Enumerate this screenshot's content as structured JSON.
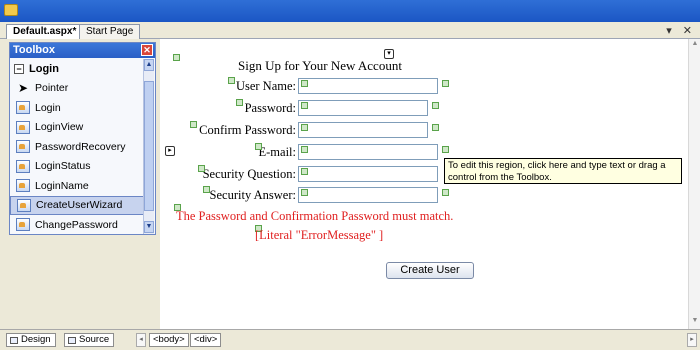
{
  "document_tabs": [
    {
      "label": "Default.aspx*",
      "active": true
    },
    {
      "label": "Start Page",
      "active": false
    }
  ],
  "tab_controls": "▾ ✕",
  "toolbox": {
    "title": "Toolbox",
    "group": {
      "expander": "−",
      "label": "Login"
    },
    "items": [
      {
        "label": "Pointer",
        "icon": "pointer-icon"
      },
      {
        "label": "Login",
        "icon": "login-icon"
      },
      {
        "label": "LoginView",
        "icon": "loginview-icon"
      },
      {
        "label": "PasswordRecovery",
        "icon": "passwordrecovery-icon"
      },
      {
        "label": "LoginStatus",
        "icon": "loginstatus-icon"
      },
      {
        "label": "LoginName",
        "icon": "loginname-icon"
      },
      {
        "label": "CreateUserWizard",
        "icon": "createuserwizard-icon",
        "selected": true
      },
      {
        "label": "ChangePassword",
        "icon": "changepassword-icon"
      }
    ]
  },
  "wizard": {
    "title": "Sign Up for Your New Account",
    "fields": [
      {
        "label": "User Name:"
      },
      {
        "label": "Password:"
      },
      {
        "label": "Confirm Password:"
      },
      {
        "label": "E-mail:"
      },
      {
        "label": "Security Question:"
      },
      {
        "label": "Security Answer:"
      }
    ],
    "compare_error": "The Password and Confirmation Password must match.",
    "literal_error": "[Literal \"ErrorMessage\" ]",
    "create_button": "Create User"
  },
  "tooltip": "To edit this region, click here and type text or drag a control from the Toolbox.",
  "bottom_bar": {
    "design_label": "Design",
    "source_label": "Source",
    "tags": [
      "<body>",
      "<div>"
    ]
  },
  "colors": {
    "title_bar": "#1b56c4",
    "error_text": "#e02020",
    "tooltip_bg": "#ffffe1",
    "selected_item": "#c7d3ee"
  }
}
